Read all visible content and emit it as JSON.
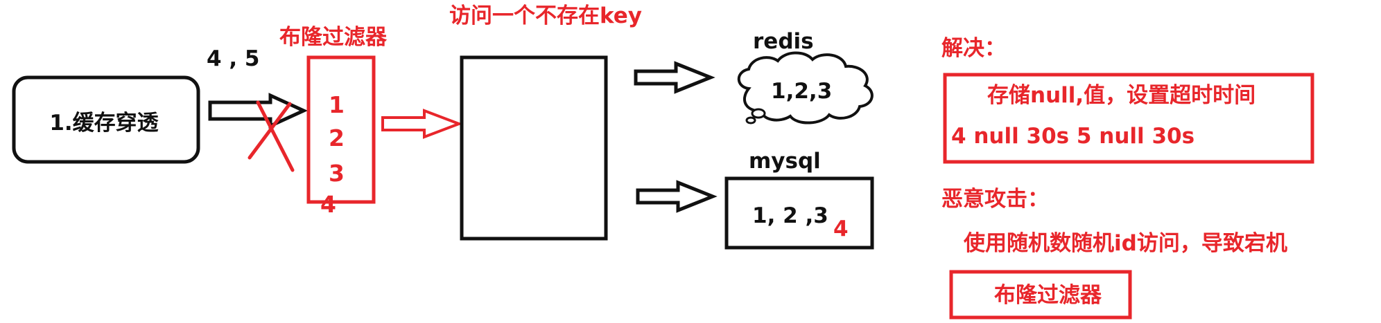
{
  "colors": {
    "red": "#e8262b",
    "black": "#111111",
    "white": "#ffffff"
  },
  "icons": {
    "redis": "cloud-icon",
    "cross": "x-mark-icon"
  },
  "labels": {
    "cache_penetration": "1.缓存穿透",
    "request_keys": "4 , 5",
    "bloom_filter_title": "布隆过滤器",
    "bloom_values": [
      "1",
      "2",
      "3",
      "4"
    ],
    "access_missing_key": "访问一个不存在key",
    "redis_title": "redis",
    "redis_values": "1,2,3",
    "mysql_title": "mysql",
    "mysql_values": "1, 2 ,3",
    "mysql_extra": "4",
    "solution_title": "解决：",
    "solution_line1": "存储null,值，设置超时时间",
    "solution_line2": "4 null 30s  5  null 30s",
    "attack_title": "恶意攻击：",
    "attack_desc": "使用随机数随机id访问，导致宕机",
    "bloom_filter_solution": "布隆过滤器"
  }
}
